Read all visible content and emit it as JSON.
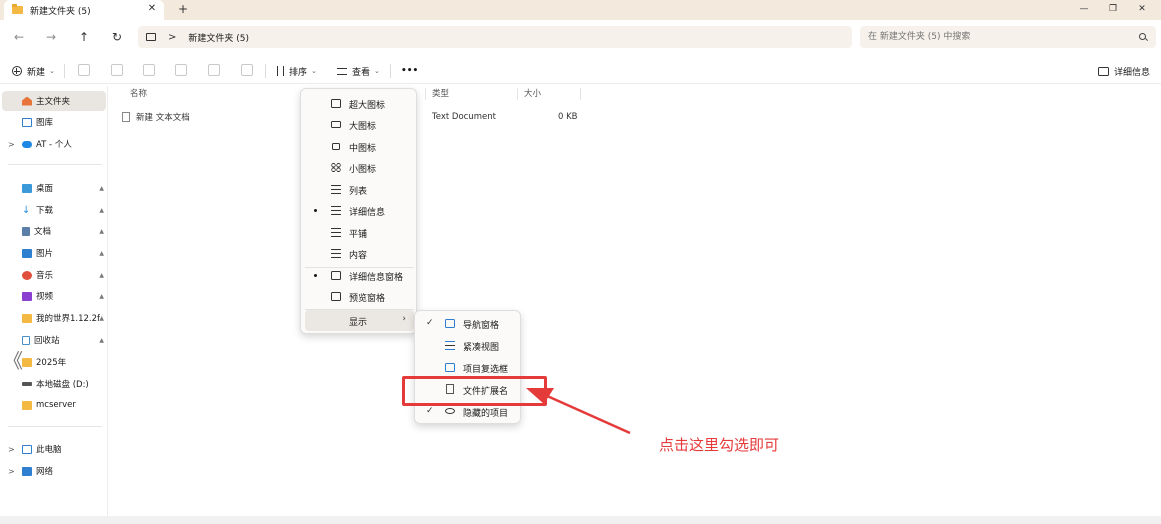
{
  "window": {
    "tab_title": "新建文件夹 (5)",
    "tab_close": "✕",
    "new_tab": "+",
    "controls": {
      "minimize": "—",
      "maximize": "❐",
      "close": "✕"
    }
  },
  "navigation": {
    "back": "←",
    "forward": "→",
    "up": "↑",
    "refresh": "↻",
    "breadcrumb_sep": ">",
    "breadcrumb": "新建文件夹 (5)",
    "search_placeholder": "在 新建文件夹 (5) 中搜索"
  },
  "toolbar": {
    "new_label": "新建",
    "sort_label": "排序",
    "view_label": "查看",
    "more_label": "•••",
    "details_pane_label": "详细信息",
    "chevron": "⌄"
  },
  "sidebar": {
    "items": [
      {
        "label": "主文件夹",
        "icon": "home-icon",
        "color": "#e8743b"
      },
      {
        "label": "图库",
        "icon": "gallery-icon",
        "color": "#2f7fd1"
      },
      {
        "label": "AT - 个人",
        "icon": "onedrive-icon",
        "color": "#1e88e5"
      },
      {
        "label": "桌面",
        "icon": "desktop-icon",
        "color": "#3a9ad9"
      },
      {
        "label": "下载",
        "icon": "download-icon",
        "color": "#2d8fe0"
      },
      {
        "label": "文档",
        "icon": "documents-icon",
        "color": "#5b7fa8"
      },
      {
        "label": "图片",
        "icon": "pictures-icon",
        "color": "#2f7fd1"
      },
      {
        "label": "音乐",
        "icon": "music-icon",
        "color": "#e0503c"
      },
      {
        "label": "视频",
        "icon": "videos-icon",
        "color": "#8a3fd1"
      },
      {
        "label": "我的世界1.12.2f",
        "icon": "folder-icon",
        "color": "#f4b942"
      },
      {
        "label": "回收站",
        "icon": "recycle-bin-icon",
        "color": "#4a90c8"
      },
      {
        "label": "2025年",
        "icon": "folder-icon",
        "color": "#f4b942"
      },
      {
        "label": "本地磁盘 (D:)",
        "icon": "drive-icon",
        "color": "#555555"
      },
      {
        "label": "mcserver",
        "icon": "folder-icon",
        "color": "#f4b942"
      },
      {
        "label": "此电脑",
        "icon": "this-pc-icon",
        "color": "#2f7fd1"
      },
      {
        "label": "网络",
        "icon": "network-icon",
        "color": "#2f7fd1"
      }
    ],
    "caret": ">",
    "pin": "📌"
  },
  "file_list": {
    "columns": [
      "名称",
      "类型",
      "大小"
    ],
    "rows": [
      {
        "name": "新建 文本文档",
        "type": "Text Document",
        "size": "0 KB"
      }
    ]
  },
  "view_menu": {
    "items": [
      {
        "label": "超大图标",
        "icon": "extra-large-icons-icon",
        "selected": false
      },
      {
        "label": "大图标",
        "icon": "large-icons-icon",
        "selected": false
      },
      {
        "label": "中图标",
        "icon": "medium-icons-icon",
        "selected": false
      },
      {
        "label": "小图标",
        "icon": "small-icons-icon",
        "selected": false
      },
      {
        "label": "列表",
        "icon": "list-icon",
        "selected": false
      },
      {
        "label": "详细信息",
        "icon": "details-icon",
        "selected": true
      },
      {
        "label": "平铺",
        "icon": "tiles-icon",
        "selected": false
      },
      {
        "label": "内容",
        "icon": "content-icon",
        "selected": false
      },
      {
        "label": "详细信息窗格",
        "icon": "details-pane-icon",
        "selected": true
      },
      {
        "label": "预览窗格",
        "icon": "preview-pane-icon",
        "selected": false
      },
      {
        "label": "显示",
        "icon": "",
        "selected": false,
        "submenu": true
      }
    ],
    "submenu_arrow": "›"
  },
  "show_menu": {
    "items": [
      {
        "label": "导航窗格",
        "icon": "navigation-pane-icon",
        "checked": true
      },
      {
        "label": "紧凑视图",
        "icon": "compact-view-icon",
        "checked": false
      },
      {
        "label": "项目复选框",
        "icon": "item-checkbox-icon",
        "checked": false
      },
      {
        "label": "文件扩展名",
        "icon": "file-extension-icon",
        "checked": false
      },
      {
        "label": "隐藏的项目",
        "icon": "hidden-items-icon",
        "checked": true
      }
    ],
    "checkmark": "✓"
  },
  "annotation": {
    "text": "点击这里勾选即可",
    "color": "#e53a3a"
  },
  "misc": {
    "collapse_chevron": "《"
  }
}
